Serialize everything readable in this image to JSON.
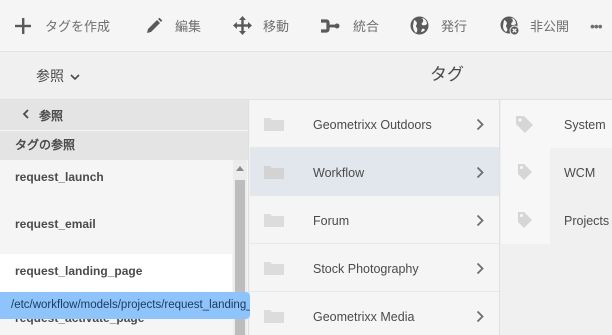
{
  "toolbar": {
    "create_label": "タグを作成",
    "edit_label": "編集",
    "move_label": "移動",
    "merge_label": "統合",
    "publish_label": "発行",
    "unpublish_label": "非公開",
    "more_label": "•••"
  },
  "subheader": {
    "reference_toggle": "参照",
    "page_title": "タグ"
  },
  "rail": {
    "back_label": "参照",
    "section_title": "タグの参照",
    "items": [
      {
        "label": "request_launch"
      },
      {
        "label": "request_email"
      },
      {
        "label": "request_landing_page"
      },
      {
        "label": "request_activate_page"
      }
    ],
    "tooltip": "/etc/workflow/models/projects/request_landing_page"
  },
  "columns": {
    "col1": [
      {
        "label": "Geometrixx Outdoors"
      },
      {
        "label": "Workflow"
      },
      {
        "label": "Forum"
      },
      {
        "label": "Stock Photography"
      },
      {
        "label": "Geometrixx Media"
      }
    ],
    "col2": [
      {
        "label": "System"
      },
      {
        "label": "WCM"
      },
      {
        "label": "Projects"
      }
    ]
  },
  "colors": {
    "selected_row": "#e2e7ee",
    "tooltip_bg": "#8fc3fb",
    "icon_gray": "#6e6e6e"
  }
}
